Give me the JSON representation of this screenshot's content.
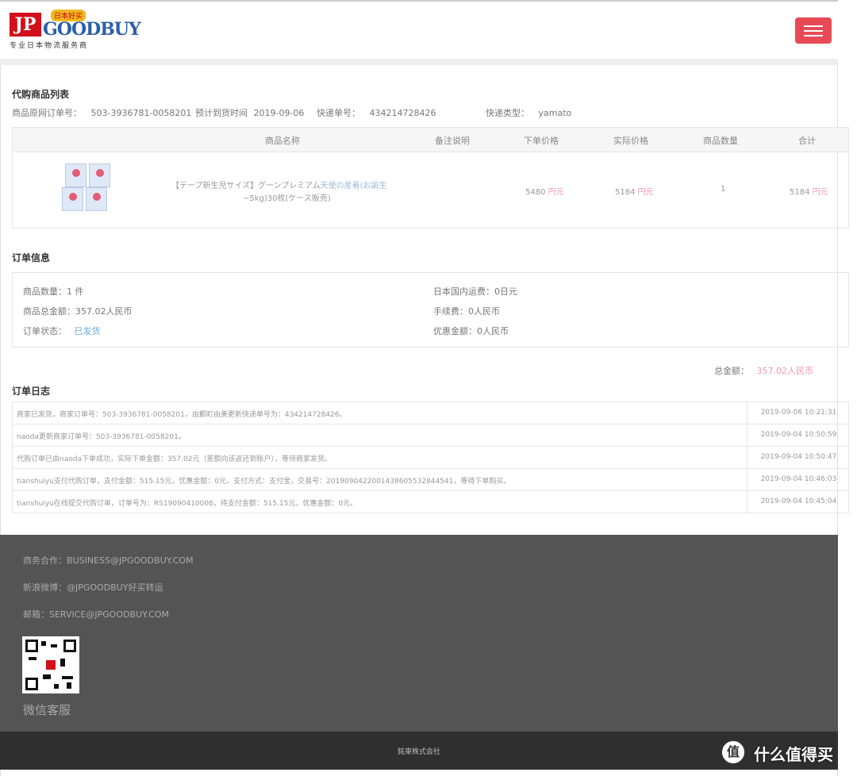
{
  "header": {
    "logo_jp": "JP",
    "logo_goodbuy": "GOODBUY",
    "logo_badge": "日本好买",
    "logo_subtitle": "专业日本物流服务商"
  },
  "product_list": {
    "title": "代购商品列表",
    "meta": {
      "merchant_order_label": "商品原网订单号：",
      "merchant_order_value": "503-3936781-0058201",
      "arrival_label": "预计到货时间",
      "arrival_value": "2019-09-06",
      "tracking_label": "快递单号：",
      "tracking_value": "434214728426",
      "courier_label": "快递类型：",
      "courier_value": "yamato"
    },
    "columns": [
      "商品名称",
      "备注说明",
      "下单价格",
      "实际价格",
      "商品数量",
      "合计"
    ],
    "rows": [
      {
        "name_line1_a": "【テープ新生児サイズ】グーンプレミアム",
        "name_line1_b": "天使の産着(お誕生",
        "name_line2": "~5kg)30枚(ケース販売)",
        "note": "",
        "order_price": "5480",
        "order_unit": "円元",
        "actual_price": "5184",
        "actual_unit": "円元",
        "quantity": "1",
        "total": "5184",
        "total_unit": "円元"
      }
    ]
  },
  "order_info": {
    "title": "订单信息",
    "quantity": "商品数量：1 件",
    "goods_total": "商品总金额：357.02人民币",
    "status_label": "订单状态：",
    "status_value": "已发货",
    "domestic_shipping": "日本国内运费：0日元",
    "service_fee": "手续费：0人民币",
    "discount": "优惠金额：0人民币",
    "grand_total_label": "总金额：",
    "grand_total_value": "357.02人民币"
  },
  "order_log": {
    "title": "订单日志",
    "entries": [
      {
        "message": "商家已发货，商家订单号：503-3936781-0058201，由郵町由美更新快递单号为：434214728426。",
        "time": "2019-09-06 10:21:31"
      },
      {
        "message": "naoda更新商家订单号：503-3936781-0058201。",
        "time": "2019-09-04 10:50:59"
      },
      {
        "message": "代购订单已由naoda下单成功，实际下单金额：357.02元（差额向该返还到账户），等待商家发货。",
        "time": "2019-09-04 10:50:47"
      },
      {
        "message": "tianshuiyu支付代购订单，支付金额：515.15元，优惠金额：0元，支付方式：支付宝，交易号：2019090422001438605532844541，等待下单购买。",
        "time": "2019-09-04 10:46:03"
      },
      {
        "message": "tianshuiyu在线提交代购订单，订单号为：RS19090410008，待支付金额：515.15元，优惠金额：0元。",
        "time": "2019-09-04 10:45:04"
      }
    ]
  },
  "footer": {
    "business": "商务合作：BUSINESS@JPGOODBUY.COM",
    "weibo": "新浪微博：@JPGOODBUY好买转运",
    "email": "邮箱：SERVICE@JPGOODBUY.COM",
    "qr_label": "微信客服",
    "copyright": "銘東株式会社"
  },
  "watermark": {
    "icon": "值",
    "text": "什么值得买"
  },
  "colors": {
    "menu_button": "#e84a55",
    "footer_bg": "#545454",
    "bottom_bar": "#2f2f2f",
    "price_pink": "#f19aa8",
    "status_blue": "#6aa9dc"
  }
}
